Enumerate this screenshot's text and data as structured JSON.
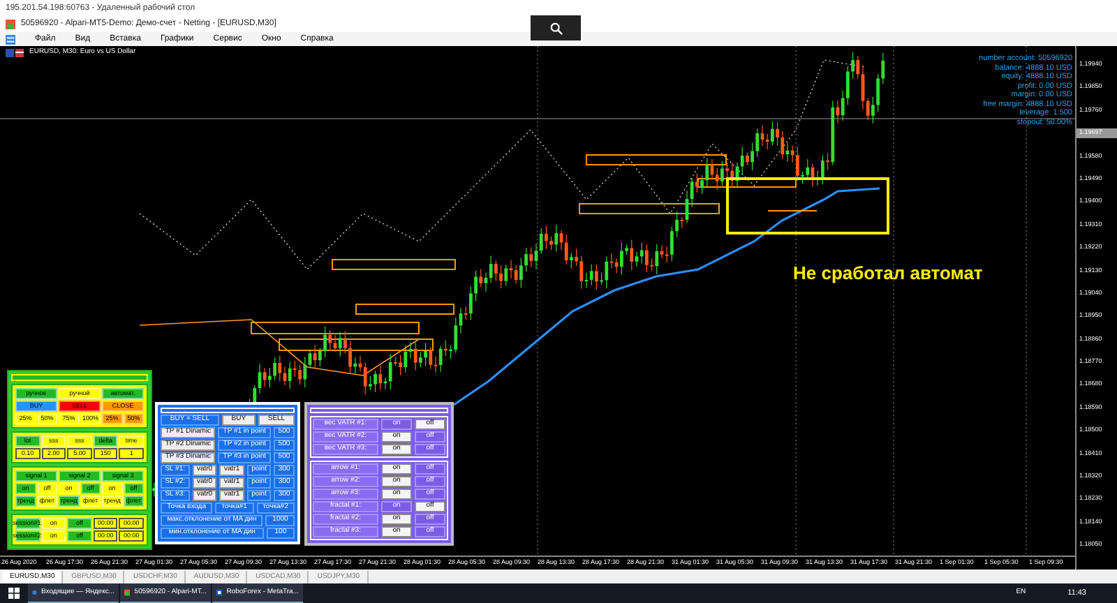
{
  "remote_title": "195.201.54.198:60763 - Удаленный рабочий стол",
  "window_title": "50596920 - Alpari-MT5-Demo: Демо-счет - Netting - [EURUSD,M30]",
  "menu": [
    "Файл",
    "Вид",
    "Вставка",
    "Графики",
    "Сервис",
    "Окно",
    "Справка"
  ],
  "chart": {
    "symbol_label": "EURUSD, M30: Euro vs US Dollar",
    "annotation": "Не сработал автомат",
    "account": [
      "number account: 50596920",
      "balance: 4888.10 USD",
      "equity: 4888.10 USD",
      "profit: 0.00 USD",
      "margin: 0.00 USD",
      "free margin: 4888.10 USD",
      "leverage: 1:500",
      "stopout: 50.00%"
    ],
    "price_axis": [
      {
        "text": "1.19940",
        "kind": "tick"
      },
      {
        "text": "1.19850",
        "kind": "tick"
      },
      {
        "text": "1.19760",
        "kind": "tick"
      },
      {
        "text": "1.19697",
        "kind": "current"
      },
      {
        "text": "1.19580",
        "kind": "tick"
      },
      {
        "text": "1.19490",
        "kind": "tick"
      },
      {
        "text": "1.19400",
        "kind": "tick"
      },
      {
        "text": "1.19310",
        "kind": "tick"
      },
      {
        "text": "1.19220",
        "kind": "tick"
      },
      {
        "text": "1.19130",
        "kind": "tick"
      },
      {
        "text": "1.19040",
        "kind": "tick"
      },
      {
        "text": "1.18950",
        "kind": "tick"
      },
      {
        "text": "1.18860",
        "kind": "tick"
      },
      {
        "text": "1.18770",
        "kind": "tick"
      },
      {
        "text": "1.18680",
        "kind": "tick"
      },
      {
        "text": "1.18590",
        "kind": "tick"
      },
      {
        "text": "1.18500",
        "kind": "tick"
      },
      {
        "text": "1.18410",
        "kind": "tick"
      },
      {
        "text": "1.18320",
        "kind": "tick"
      },
      {
        "text": "1.18230",
        "kind": "tick"
      },
      {
        "text": "1.18140",
        "kind": "tick"
      },
      {
        "text": "1.18050",
        "kind": "tick"
      }
    ],
    "time_axis": [
      "26 Aug 2020",
      "26 Aug 17:30",
      "26 Aug 21:30",
      "27 Aug 01:30",
      "27 Aug 05:30",
      "27 Aug 09:30",
      "27 Aug 13:30",
      "27 Aug 17:30",
      "27 Aug 21:30",
      "28 Aug 01:30",
      "28 Aug 05:30",
      "28 Aug 09:30",
      "28 Aug 13:30",
      "28 Aug 17:30",
      "28 Aug 21:30",
      "31 Aug 01:30",
      "31 Aug 05:30",
      "31 Aug 09:30",
      "31 Aug 13:30",
      "31 Aug 17:30",
      "31 Aug 21:30",
      "1 Sep 01:30",
      "1 Sep 05:30",
      "1 Sep 09:30"
    ]
  },
  "left_panel": {
    "sections": [
      [
        [
          {
            "text": "ручное",
            "color": "#22bb22",
            "kind": "button"
          },
          {
            "text": "ручной",
            "color": "#ffff00",
            "kind": "button"
          },
          {
            "text": "автомат.",
            "color": "#22bb22",
            "kind": "button"
          }
        ],
        [
          {
            "text": "BUY",
            "color": "#2196f3",
            "kind": "button"
          },
          {
            "text": "SELL",
            "color": "#ff0000",
            "kind": "button"
          },
          {
            "text": "CLOSE",
            "color": "#ff9900",
            "kind": "button"
          }
        ],
        [
          {
            "text": "25%",
            "color": "#ffff00",
            "kind": "button"
          },
          {
            "text": "50%",
            "color": "#ffff00",
            "kind": "button"
          },
          {
            "text": "75%",
            "color": "#ffff00",
            "kind": "button"
          },
          {
            "text": "100%",
            "color": "#ffff00",
            "kind": "button"
          },
          {
            "text": "25%",
            "color": "#ff9900",
            "kind": "button"
          },
          {
            "text": "50%",
            "color": "#ff9900",
            "kind": "button"
          }
        ]
      ],
      [
        [
          {
            "text": "lot",
            "color": "#22bb22",
            "kind": "button"
          },
          {
            "text": "sss",
            "color": "#ffff00",
            "kind": "button"
          },
          {
            "text": "sss",
            "color": "#ffff00",
            "kind": "button"
          },
          {
            "text": "delta",
            "color": "#22bb22",
            "kind": "button"
          },
          {
            "text": "time",
            "color": "#ffff00",
            "kind": "button"
          }
        ],
        [
          {
            "text": "0.10",
            "color": "#ffff00",
            "kind": "field"
          },
          {
            "text": "2.00",
            "color": "#ffff00",
            "kind": "field"
          },
          {
            "text": "5.00",
            "color": "#ffff00",
            "kind": "field"
          },
          {
            "text": "150",
            "color": "#ffff00",
            "kind": "field"
          },
          {
            "text": "1",
            "color": "#ffff00",
            "kind": "field"
          }
        ]
      ],
      [
        [
          {
            "text": "signal 1",
            "color": "#22bb22",
            "kind": "button"
          },
          {
            "text": "signal 2",
            "color": "#22bb22",
            "kind": "button"
          },
          {
            "text": "signal 3",
            "color": "#22bb22",
            "kind": "button"
          }
        ],
        [
          {
            "text": "on",
            "color": "#22bb22",
            "kind": "button"
          },
          {
            "text": "off",
            "color": "#ffff00",
            "kind": "button"
          },
          {
            "text": "on",
            "color": "#ffff00",
            "kind": "button"
          },
          {
            "text": "off",
            "color": "#22bb22",
            "kind": "button"
          },
          {
            "text": "on",
            "color": "#ffff00",
            "kind": "button"
          },
          {
            "text": "off",
            "color": "#22bb22",
            "kind": "button"
          }
        ],
        [
          {
            "text": "тренд",
            "color": "#22bb22",
            "kind": "button"
          },
          {
            "text": "флет",
            "color": "#ffff00",
            "kind": "button"
          },
          {
            "text": "тренд",
            "color": "#22bb22",
            "kind": "button"
          },
          {
            "text": "флет",
            "color": "#ffff00",
            "kind": "button"
          },
          {
            "text": "тренд",
            "color": "#ffff00",
            "kind": "button"
          },
          {
            "text": "флет",
            "color": "#22bb22",
            "kind": "button"
          }
        ]
      ],
      [
        [
          {
            "text": "session#1:",
            "color": "#22bb22",
            "kind": "button"
          },
          {
            "text": "on",
            "color": "#ffff00",
            "kind": "button"
          },
          {
            "text": "off",
            "color": "#22bb22",
            "kind": "button"
          },
          {
            "text": "00:00",
            "color": "#ffff00",
            "kind": "field"
          },
          {
            "text": "00:00",
            "color": "#ffff00",
            "kind": "field"
          }
        ],
        [
          {
            "text": "session#2:",
            "color": "#22bb22",
            "kind": "button"
          },
          {
            "text": "on",
            "color": "#ffff00",
            "kind": "button"
          },
          {
            "text": "off",
            "color": "#22bb22",
            "kind": "button"
          },
          {
            "text": "00:00",
            "color": "#ffff00",
            "kind": "field"
          },
          {
            "text": "00:00",
            "color": "#ffff00",
            "kind": "field"
          }
        ]
      ]
    ]
  },
  "middle_panel": {
    "rows": [
      [
        {
          "text": "BUY = SELL",
          "color": "#1a6fe8"
        },
        {
          "text": "BUY",
          "color": "#eeeeee"
        },
        {
          "text": "SELL",
          "color": "#eeeeee"
        }
      ],
      [
        {
          "text": "TP #1 Dinamic",
          "color": "#eeeeee"
        },
        {
          "text": "TP #1 in point",
          "color": "#1a6fe8"
        },
        {
          "text": "500",
          "color": "#1a6fe8"
        }
      ],
      [
        {
          "text": "TP #2 Dinamic",
          "color": "#eeeeee"
        },
        {
          "text": "TP #2 in point",
          "color": "#1a6fe8"
        },
        {
          "text": "500",
          "color": "#1a6fe8"
        }
      ],
      [
        {
          "text": "TP #3 Dinamic",
          "color": "#eeeeee"
        },
        {
          "text": "TP #3 in point",
          "color": "#1a6fe8"
        },
        {
          "text": "500",
          "color": "#1a6fe8"
        }
      ],
      [
        {
          "text": "SL #1:",
          "color": "#1a6fe8"
        },
        {
          "text": "vatr0",
          "color": "#eeeeee"
        },
        {
          "text": "vatr1",
          "color": "#eeeeee"
        },
        {
          "text": "point",
          "color": "#1a6fe8"
        },
        {
          "text": "300",
          "color": "#1a6fe8"
        }
      ],
      [
        {
          "text": "SL #2:",
          "color": "#1a6fe8"
        },
        {
          "text": "vatr0",
          "color": "#eeeeee"
        },
        {
          "text": "vatr1",
          "color": "#eeeeee"
        },
        {
          "text": "point",
          "color": "#1a6fe8"
        },
        {
          "text": "300",
          "color": "#1a6fe8"
        }
      ],
      [
        {
          "text": "SL #3:",
          "color": "#1a6fe8"
        },
        {
          "text": "vatr0",
          "color": "#eeeeee"
        },
        {
          "text": "vatr1",
          "color": "#eeeeee"
        },
        {
          "text": "point",
          "color": "#1a6fe8"
        },
        {
          "text": "300",
          "color": "#1a6fe8"
        }
      ],
      [
        {
          "text": "Точка входа",
          "color": "#1a6fe8"
        },
        {
          "text": "точка#1",
          "color": "#1a6fe8"
        },
        {
          "text": "точка#2",
          "color": "#1a6fe8"
        }
      ],
      [
        {
          "text": "макс.отклонение от MA дин",
          "color": "#1a6fe8"
        },
        {
          "text": "1000",
          "color": "#1a6fe8"
        }
      ],
      [
        {
          "text": "мин.отклонение от MA дин",
          "color": "#1a6fe8"
        },
        {
          "text": "100",
          "color": "#1a6fe8"
        }
      ]
    ]
  },
  "right_panel": {
    "sections": [
      [
        {
          "label": "вес VATR #1:",
          "on_selected": false,
          "off_selected": true,
          "on": "on",
          "off": "off"
        },
        {
          "label": "вес VATR #2:",
          "on_selected": true,
          "off_selected": false,
          "on": "on",
          "off": "off"
        },
        {
          "label": "вес VATR #3:",
          "on_selected": true,
          "off_selected": false,
          "on": "on",
          "off": "off"
        }
      ],
      [
        {
          "label": "arrow #1:",
          "on_selected": true,
          "off_selected": false,
          "on": "on",
          "off": "off"
        },
        {
          "label": "arrow #2:",
          "on_selected": true,
          "off_selected": false,
          "on": "on",
          "off": "off"
        },
        {
          "label": "arrow #3:",
          "on_selected": true,
          "off_selected": false,
          "on": "on",
          "off": "off"
        },
        {
          "label": "fractal #1:",
          "on_selected": false,
          "off_selected": true,
          "on": "on",
          "off": "off"
        },
        {
          "label": "fractal #2:",
          "on_selected": true,
          "off_selected": false,
          "on": "on",
          "off": "off"
        },
        {
          "label": "fractal #3:",
          "on_selected": true,
          "off_selected": false,
          "on": "on",
          "off": "off"
        }
      ]
    ]
  },
  "symbol_tabs": [
    {
      "label": "EURUSD,M30",
      "selected": true
    },
    {
      "label": "GBPUSD,M30",
      "selected": false
    },
    {
      "label": "USDCHF,M30",
      "selected": false
    },
    {
      "label": "AUDUSD,M30",
      "selected": false
    },
    {
      "label": "USDCAD,M30",
      "selected": false
    },
    {
      "label": "USDJPY,M30",
      "selected": false
    }
  ],
  "taskbar": {
    "items": [
      {
        "label": "Входящие — Яндекс...",
        "kind": "mail"
      },
      {
        "label": "50596920 - Alpari-MT...",
        "kind": "mt"
      },
      {
        "label": "RoboForex - MetaTra...",
        "kind": "robo"
      }
    ],
    "language": "EN",
    "time": "11:43"
  }
}
